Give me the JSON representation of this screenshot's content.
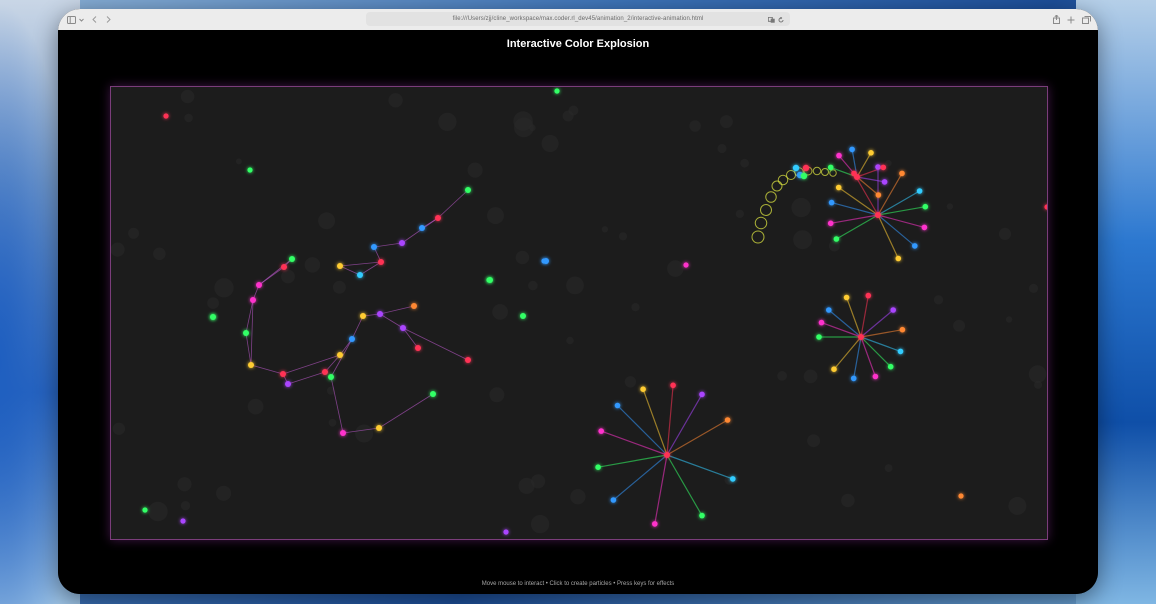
{
  "browser": {
    "url": "file:///Users/zjj/cline_workspace/max.coder.rl_dev45/animation_2/interactive-animation.html",
    "toolbar_icons": {
      "sidebar": "sidebar-icon",
      "chevron": "chevron-down-icon",
      "back": "back-icon",
      "forward": "forward-icon",
      "translate": "translate-icon",
      "reload": "reload-icon",
      "share": "share-icon",
      "new_tab": "plus-icon",
      "tabs": "tab-overview-icon"
    }
  },
  "page": {
    "title": "Interactive Color Explosion",
    "instructions": "Move mouse to interact • Click to create particles • Press keys for effects"
  },
  "colors": {
    "background": "#000000",
    "canvas": "#1c1c1c",
    "canvas_border": "#c85ac8",
    "title": "#ffffff",
    "instructions": "#a6a6a6"
  },
  "particle_palette": [
    "#33ff66",
    "#ff33cc",
    "#3399ff",
    "#ffcc33",
    "#ff3355",
    "#aa44ff",
    "#ff8833",
    "#33ccff"
  ]
}
